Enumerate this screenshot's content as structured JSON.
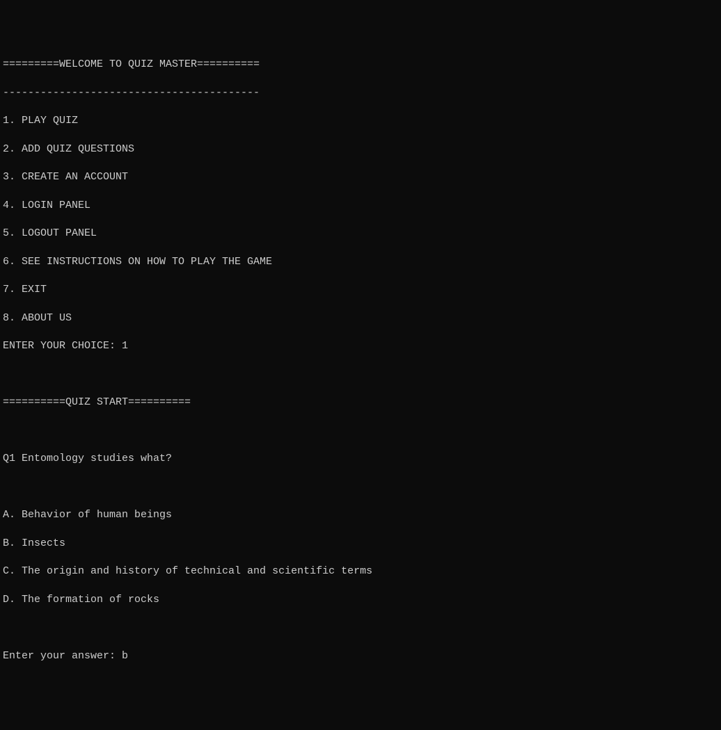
{
  "header_line": "=========WELCOME TO QUIZ MASTER==========",
  "divider": "-----------------------------------------",
  "menu": {
    "items": [
      "1. PLAY QUIZ",
      "2. ADD QUIZ QUESTIONS",
      "3. CREATE AN ACCOUNT",
      "4. LOGIN PANEL",
      "5. LOGOUT PANEL",
      "6. SEE INSTRUCTIONS ON HOW TO PLAY THE GAME",
      "7. EXIT",
      "8. ABOUT US"
    ]
  },
  "choice_prompt": "ENTER YOUR CHOICE: ",
  "choice_value": "1",
  "quiz_header": "==========QUIZ START==========",
  "question": {
    "label": "Q1 Entomology studies what?",
    "options": [
      "A. Behavior of human beings",
      "B. Insects",
      "C. The origin and history of technical and scientific terms",
      "D. The formation of rocks"
    ]
  },
  "answer_prompt": "Enter your answer: ",
  "answer_value": "b"
}
